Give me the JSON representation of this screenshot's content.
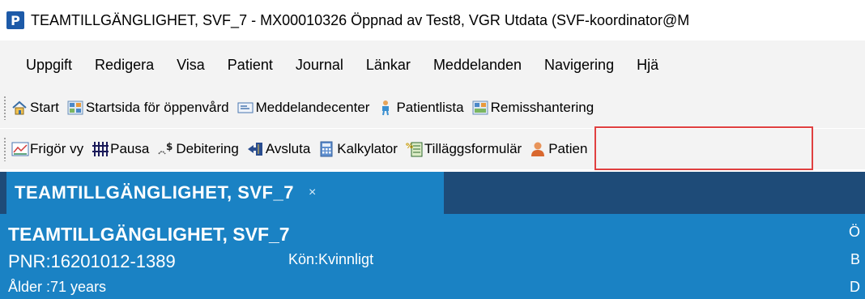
{
  "window": {
    "title": "TEAMTILLGÄNGLIGHET, SVF_7 - MX00010326 Öppnad av Test8, VGR Utdata (SVF-koordinator@M",
    "app_icon_letter": "P"
  },
  "menubar": {
    "items": [
      "Uppgift",
      "Redigera",
      "Visa",
      "Patient",
      "Journal",
      "Länkar",
      "Meddelanden",
      "Navigering",
      "Hjä"
    ]
  },
  "toolbar1": {
    "items": [
      {
        "label": "Start",
        "icon": "home-icon"
      },
      {
        "label": "Startsida för öppenvård",
        "icon": "dashboard-icon"
      },
      {
        "label": "Meddelandecenter",
        "icon": "message-center-icon"
      },
      {
        "label": "Patientlista",
        "icon": "patient-list-icon"
      },
      {
        "label": "Remisshantering",
        "icon": "referral-icon"
      }
    ]
  },
  "toolbar2": {
    "items": [
      {
        "label": "Frigör vy",
        "icon": "release-view-icon"
      },
      {
        "label": "Pausa",
        "icon": "pause-grid-icon"
      },
      {
        "label": "Debitering",
        "icon": "billing-icon"
      },
      {
        "label": "Avsluta",
        "icon": "exit-icon"
      },
      {
        "label": "Kalkylator",
        "icon": "calculator-icon"
      },
      {
        "label": "Tilläggsformulär",
        "icon": "additional-form-icon"
      },
      {
        "label": "Patien",
        "icon": "patient-icon"
      }
    ]
  },
  "tab": {
    "title": "TEAMTILLGÄNGLIGHET, SVF_7",
    "close": "×"
  },
  "patient": {
    "name": "TEAMTILLGÄNGLIGHET, SVF_7",
    "pnr": "PNR:16201012-1389",
    "gender": "Kön:Kvinnligt",
    "age": "Ålder :71 years",
    "right_letters": [
      "Ö",
      "B",
      "D"
    ]
  },
  "colors": {
    "header_blue": "#1a82c4",
    "tabstrip_dark": "#1e4b78",
    "highlight": "#e04040"
  }
}
